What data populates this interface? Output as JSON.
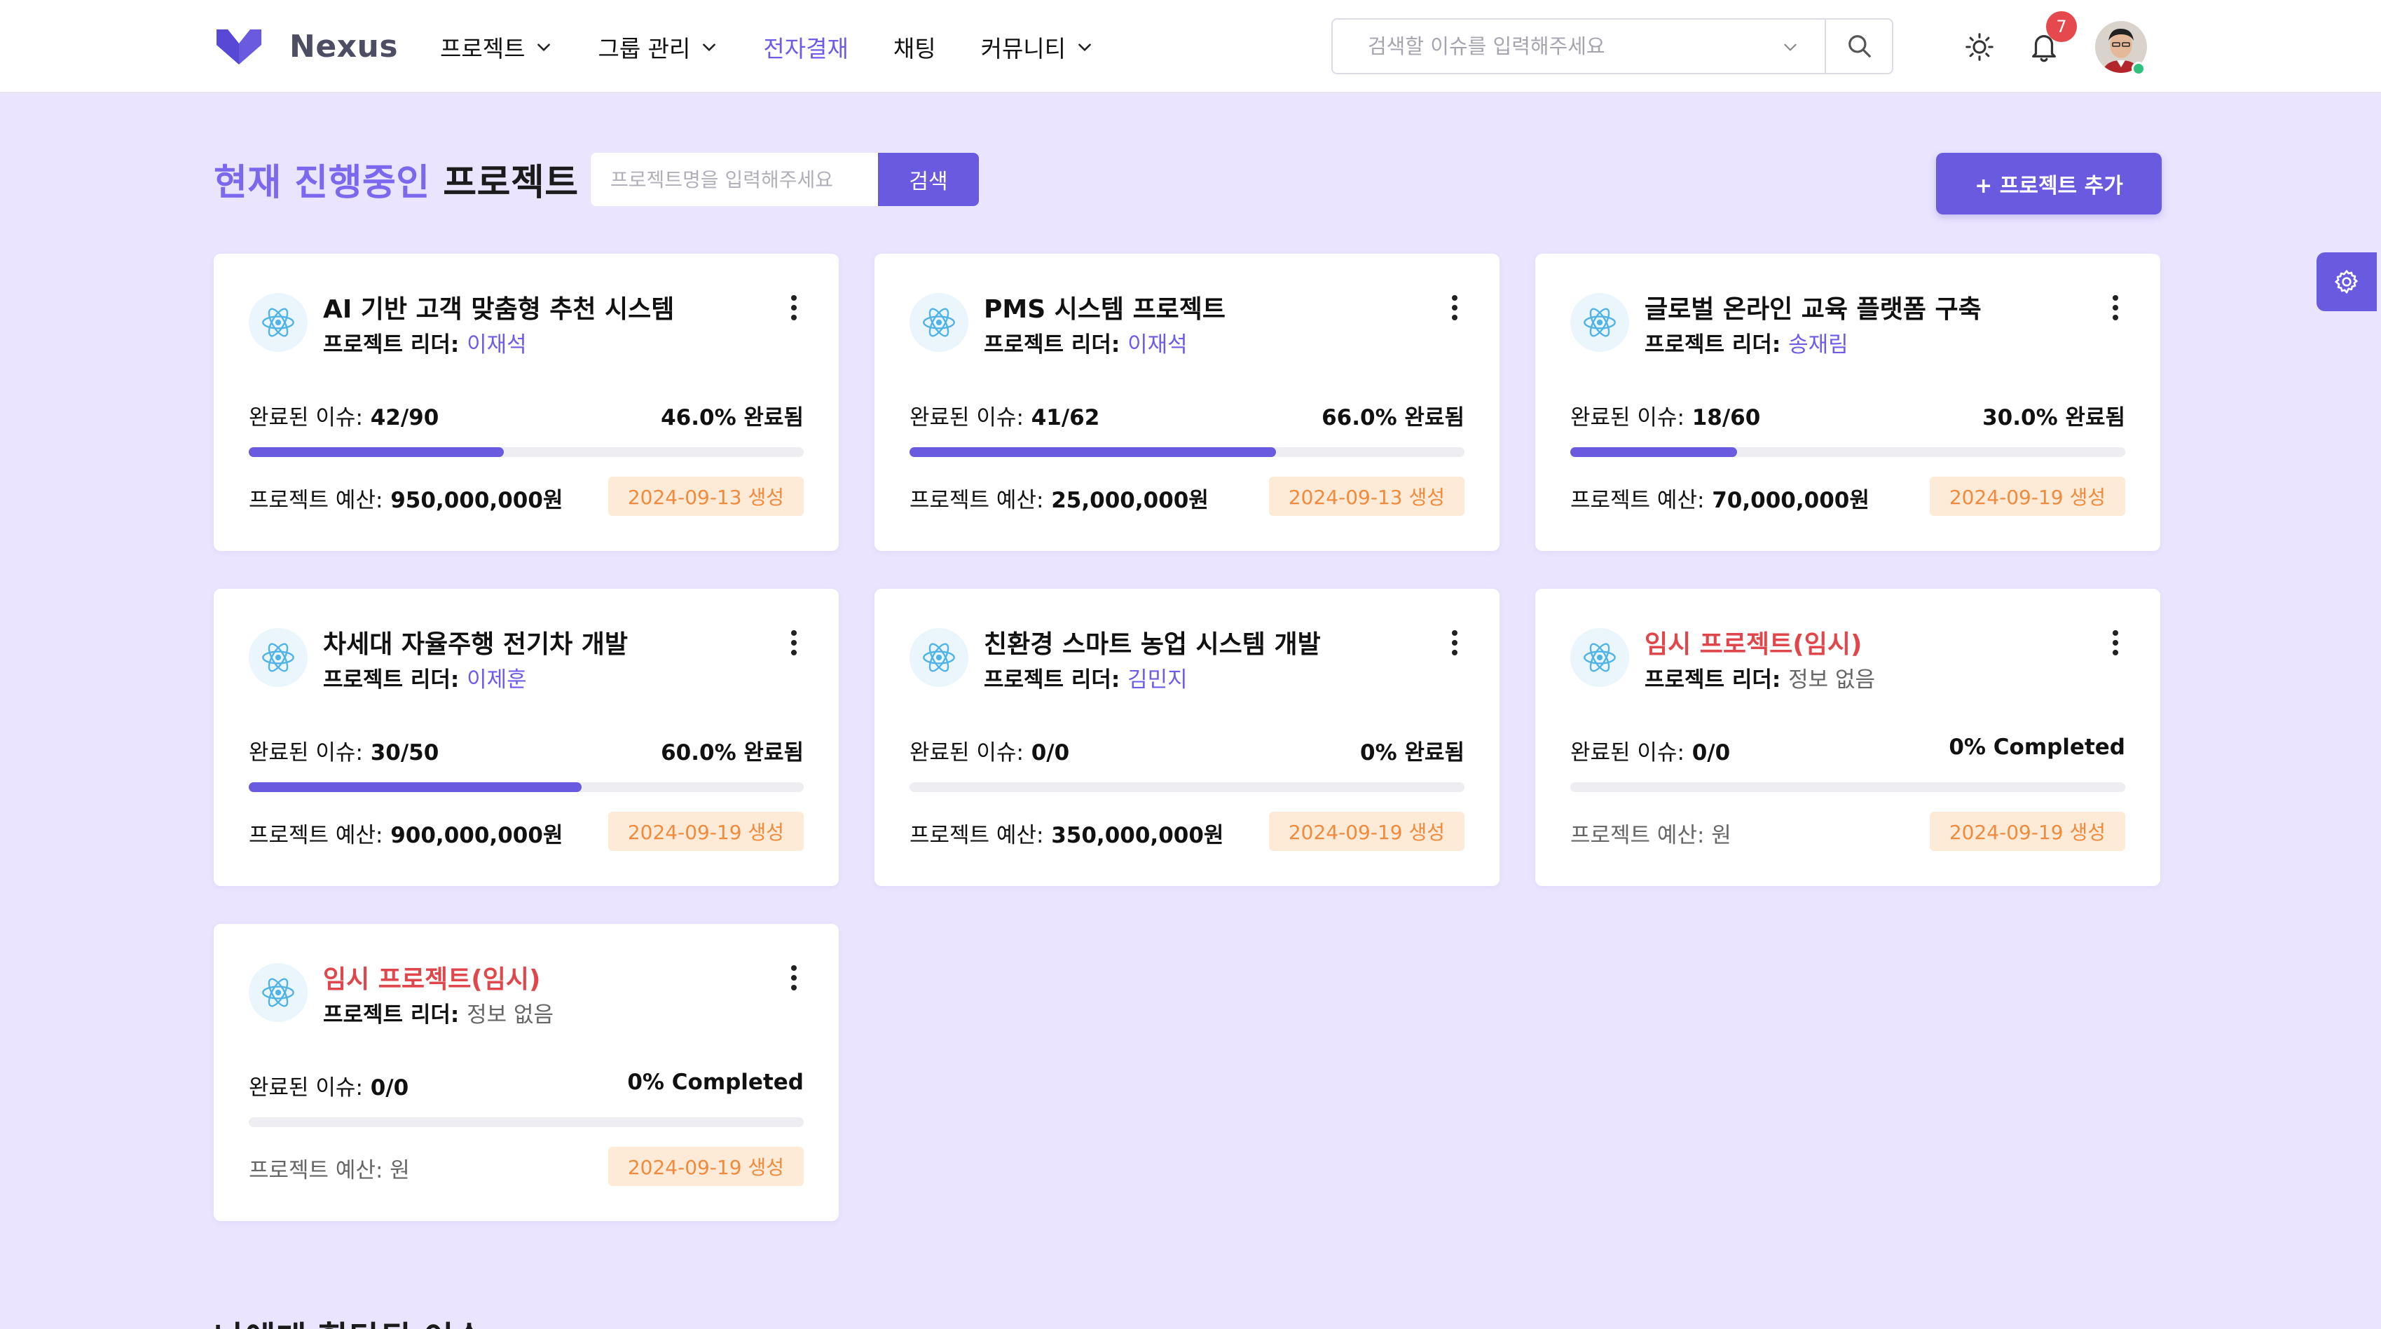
{
  "app": {
    "name": "Nexus",
    "brand_color": "#6a5ae0"
  },
  "nav": [
    {
      "label": "프로젝트",
      "dropdown": true,
      "active": false
    },
    {
      "label": "그룹 관리",
      "dropdown": true,
      "active": false
    },
    {
      "label": "전자결재",
      "dropdown": false,
      "active": true
    },
    {
      "label": "채팅",
      "dropdown": false,
      "active": false
    },
    {
      "label": "커뮤니티",
      "dropdown": true,
      "active": false
    }
  ],
  "header_search": {
    "placeholder": "검색할 이슈를 입력해주세요"
  },
  "notifications": {
    "count": "7"
  },
  "main": {
    "title_accent": "현재 진행중인",
    "title_rest": "프로젝트",
    "search_placeholder": "프로젝트명을 입력해주세요",
    "search_button": "검색",
    "add_button": "+ 프로젝트 추가",
    "next_section_heading": "나에게 할당된 이슈"
  },
  "projects": [
    {
      "title": "AI 기반 고객 맞춤형 추천 시스템",
      "temp": false,
      "leader_label": "프로젝트 리더:",
      "leader": "이재석",
      "issues_label": "완료된 이슈:",
      "issues": "42/90",
      "progress": 0.46,
      "percent_text": "46.0% 완료됨",
      "budget_label": "프로젝트 예산:",
      "budget": "950,000,000원",
      "created": "2024-09-13 생성"
    },
    {
      "title": "PMS 시스템 프로젝트",
      "temp": false,
      "leader_label": "프로젝트 리더:",
      "leader": "이재석",
      "issues_label": "완료된 이슈:",
      "issues": "41/62",
      "progress": 0.66,
      "percent_text": "66.0% 완료됨",
      "budget_label": "프로젝트 예산:",
      "budget": "25,000,000원",
      "created": "2024-09-13 생성"
    },
    {
      "title": "글로벌 온라인 교육 플랫폼 구축",
      "temp": false,
      "leader_label": "프로젝트 리더:",
      "leader": "송재림",
      "issues_label": "완료된 이슈:",
      "issues": "18/60",
      "progress": 0.3,
      "percent_text": "30.0% 완료됨",
      "budget_label": "프로젝트 예산:",
      "budget": "70,000,000원",
      "created": "2024-09-19 생성"
    },
    {
      "title": "차세대 자율주행 전기차 개발",
      "temp": false,
      "leader_label": "프로젝트 리더:",
      "leader": "이제훈",
      "issues_label": "완료된 이슈:",
      "issues": "30/50",
      "progress": 0.6,
      "percent_text": "60.0% 완료됨",
      "budget_label": "프로젝트 예산:",
      "budget": "900,000,000원",
      "created": "2024-09-19 생성"
    },
    {
      "title": "친환경 스마트 농업 시스템 개발",
      "temp": false,
      "leader_label": "프로젝트 리더:",
      "leader": "김민지",
      "issues_label": "완료된 이슈:",
      "issues": "0/0",
      "progress": 0,
      "percent_text": "0% 완료됨",
      "budget_label": "프로젝트 예산:",
      "budget": "350,000,000원",
      "created": "2024-09-19 생성"
    },
    {
      "title": "임시 프로젝트(임시)",
      "temp": true,
      "leader_label": "프로젝트 리더:",
      "leader": "정보 없음",
      "issues_label": "완료된 이슈:",
      "issues": "0/0",
      "progress": 0,
      "percent_text": "0% Completed",
      "budget_label": "프로젝트 예산:",
      "budget": "원",
      "created": "2024-09-19 생성"
    },
    {
      "title": "임시 프로젝트(임시)",
      "temp": true,
      "leader_label": "프로젝트 리더:",
      "leader": "정보 없음",
      "issues_label": "완료된 이슈:",
      "issues": "0/0",
      "progress": 0,
      "percent_text": "0% Completed",
      "budget_label": "프로젝트 예산:",
      "budget": "원",
      "created": "2024-09-19 생성"
    }
  ]
}
